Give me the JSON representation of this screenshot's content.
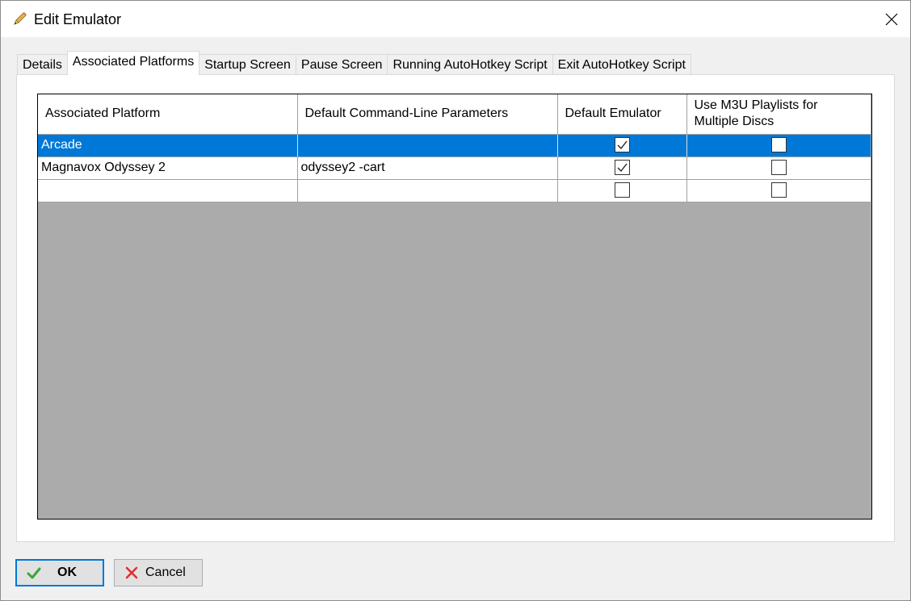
{
  "window": {
    "title": "Edit Emulator",
    "title_icon": "pencil-icon",
    "close_icon": "close-icon"
  },
  "tabs": [
    {
      "label": "Details",
      "active": false
    },
    {
      "label": "Associated Platforms",
      "active": true
    },
    {
      "label": "Startup Screen",
      "active": false
    },
    {
      "label": "Pause Screen",
      "active": false
    },
    {
      "label": "Running AutoHotkey Script",
      "active": false
    },
    {
      "label": "Exit AutoHotkey Script",
      "active": false
    }
  ],
  "grid": {
    "columns": [
      "Associated Platform",
      "Default Command-Line Parameters",
      "Default Emulator",
      "Use M3U Playlists for Multiple Discs"
    ],
    "rows": [
      {
        "platform": "Arcade",
        "params": "",
        "default_emulator": true,
        "use_m3u": false,
        "selected": true
      },
      {
        "platform": "Magnavox Odyssey 2",
        "params": "odyssey2 -cart",
        "default_emulator": true,
        "use_m3u": false,
        "selected": false
      },
      {
        "platform": "",
        "params": "",
        "default_emulator": false,
        "use_m3u": false,
        "selected": false
      }
    ]
  },
  "buttons": {
    "ok": {
      "label": "OK",
      "icon": "checkmark-icon"
    },
    "cancel": {
      "label": "Cancel",
      "icon": "x-icon"
    }
  },
  "colors": {
    "selection": "#0078d7",
    "grid_empty_area": "#ababab",
    "ok_check": "#3aa63a",
    "cancel_x": "#e03030"
  }
}
